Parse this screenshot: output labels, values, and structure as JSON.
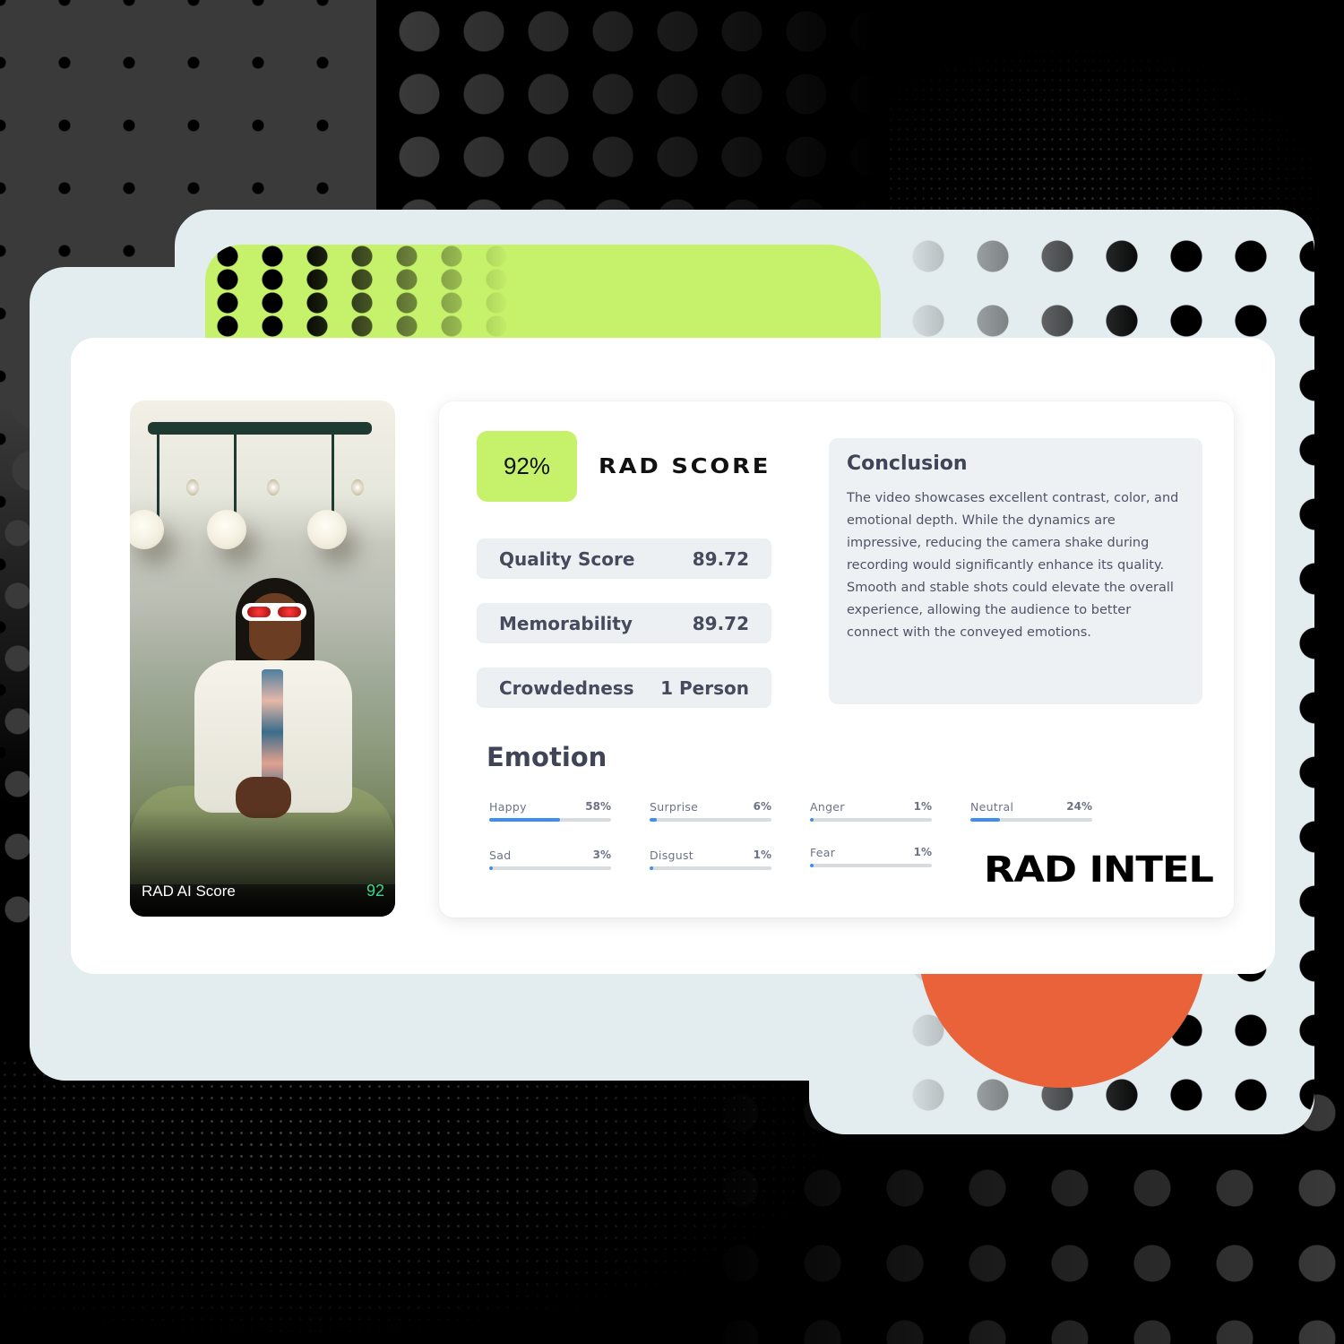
{
  "photo_card": {
    "label": "RAD AI Score",
    "score": "92"
  },
  "rad_score": {
    "value": "92%",
    "title": "RAD SCORE",
    "badge_color": "#c6f16a"
  },
  "metrics": [
    {
      "label": "Quality Score",
      "value": "89.72"
    },
    {
      "label": "Memorability",
      "value": "89.72"
    },
    {
      "label": "Crowdedness",
      "value": "1 Person"
    }
  ],
  "conclusion": {
    "title": "Conclusion",
    "body": "The video showcases excellent contrast, color, and emotional depth. While the dynamics are impressive, reducing the camera shake during recording would significantly enhance its quality. Smooth and stable shots could elevate the overall experience, allowing the audience to better connect with the conveyed emotions."
  },
  "emotion": {
    "title": "Emotion",
    "bar_color": "#3d8ef0",
    "items": [
      {
        "label": "Happy",
        "value": "58%",
        "percent": 58
      },
      {
        "label": "Surprise",
        "value": "6%",
        "percent": 6
      },
      {
        "label": "Anger",
        "value": "1%",
        "percent": 1
      },
      {
        "label": "Neutral",
        "value": "24%",
        "percent": 24
      },
      {
        "label": "Sad",
        "value": "3%",
        "percent": 3
      },
      {
        "label": "Disgust",
        "value": "1%",
        "percent": 1
      },
      {
        "label": "Fear",
        "value": "1%",
        "percent": 1
      }
    ]
  },
  "brand": {
    "logo_text": "RAD INTEL"
  },
  "colors": {
    "accent_lime": "#c6f16a",
    "accent_orange": "#e9623a",
    "score_green": "#3ed68a",
    "frame": "#e3ecef"
  }
}
